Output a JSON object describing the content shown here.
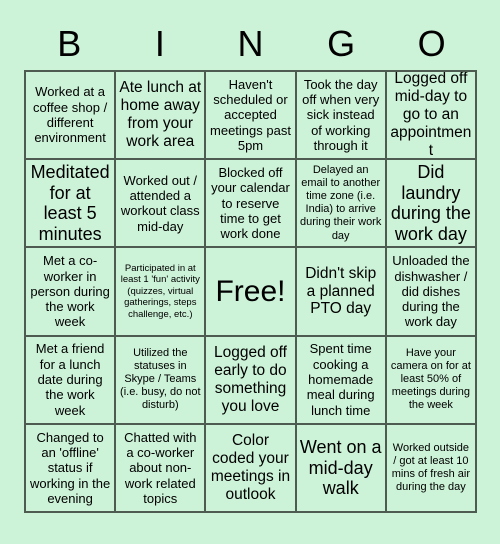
{
  "header": {
    "letters": [
      "B",
      "I",
      "N",
      "G",
      "O"
    ]
  },
  "colors": {
    "background": "#ccf2d7",
    "cell_background": "#ccf2d7",
    "grid_line": "#4d5b50",
    "text": "#000000"
  },
  "grid": {
    "rows": 5,
    "columns": 5,
    "cells": [
      {
        "text": "Worked at a coffee shop / different environment",
        "size": "sz-md",
        "free": false
      },
      {
        "text": "Ate lunch at home away from your work area",
        "size": "sz-lg",
        "free": false
      },
      {
        "text": "Haven't scheduled or accepted meetings past 5pm",
        "size": "sz-md",
        "free": false
      },
      {
        "text": "Took the day off when very sick instead of working through it",
        "size": "sz-md",
        "free": false
      },
      {
        "text": "Logged off mid-day to go to an appointment",
        "size": "sz-lg",
        "free": false
      },
      {
        "text": "Meditated for at least 5 minutes",
        "size": "sz-xl",
        "free": false
      },
      {
        "text": "Worked out / attended a workout class mid-day",
        "size": "sz-md",
        "free": false
      },
      {
        "text": "Blocked off your calendar to reserve time to get work done",
        "size": "sz-md",
        "free": false
      },
      {
        "text": "Delayed an email to another time zone (i.e. India) to arrive during their work day",
        "size": "sz-sm",
        "free": false
      },
      {
        "text": "Did laundry during the work day",
        "size": "sz-xl",
        "free": false
      },
      {
        "text": "Met a co-worker in person during the work week",
        "size": "sz-md",
        "free": false
      },
      {
        "text": "Participated in at least 1 'fun' activity (quizzes, virtual gatherings, steps challenge, etc.)",
        "size": "sz-xs",
        "free": false
      },
      {
        "text": "Free!",
        "size": "sz-free",
        "free": true
      },
      {
        "text": "Didn't skip a planned PTO day",
        "size": "sz-lg",
        "free": false
      },
      {
        "text": "Unloaded the dishwasher / did dishes during the work day",
        "size": "sz-md",
        "free": false
      },
      {
        "text": "Met a friend for a lunch date during the work week",
        "size": "sz-md",
        "free": false
      },
      {
        "text": "Utilized the statuses in Skype / Teams (i.e. busy, do not disturb)",
        "size": "sz-sm",
        "free": false
      },
      {
        "text": "Logged off early to do something you love",
        "size": "sz-lg",
        "free": false
      },
      {
        "text": "Spent time cooking a homemade meal during lunch time",
        "size": "sz-md",
        "free": false
      },
      {
        "text": "Have your camera on for at least 50% of meetings during the week",
        "size": "sz-sm",
        "free": false
      },
      {
        "text": "Changed to an 'offline' status if working in the evening",
        "size": "sz-md",
        "free": false
      },
      {
        "text": "Chatted with a co-worker about non-work related topics",
        "size": "sz-md",
        "free": false
      },
      {
        "text": "Color coded your meetings in outlook",
        "size": "sz-lg",
        "free": false
      },
      {
        "text": "Went on a mid-day walk",
        "size": "sz-xl",
        "free": false
      },
      {
        "text": "Worked outside / got at least 10 mins of fresh air during the day",
        "size": "sz-sm",
        "free": false
      }
    ]
  }
}
